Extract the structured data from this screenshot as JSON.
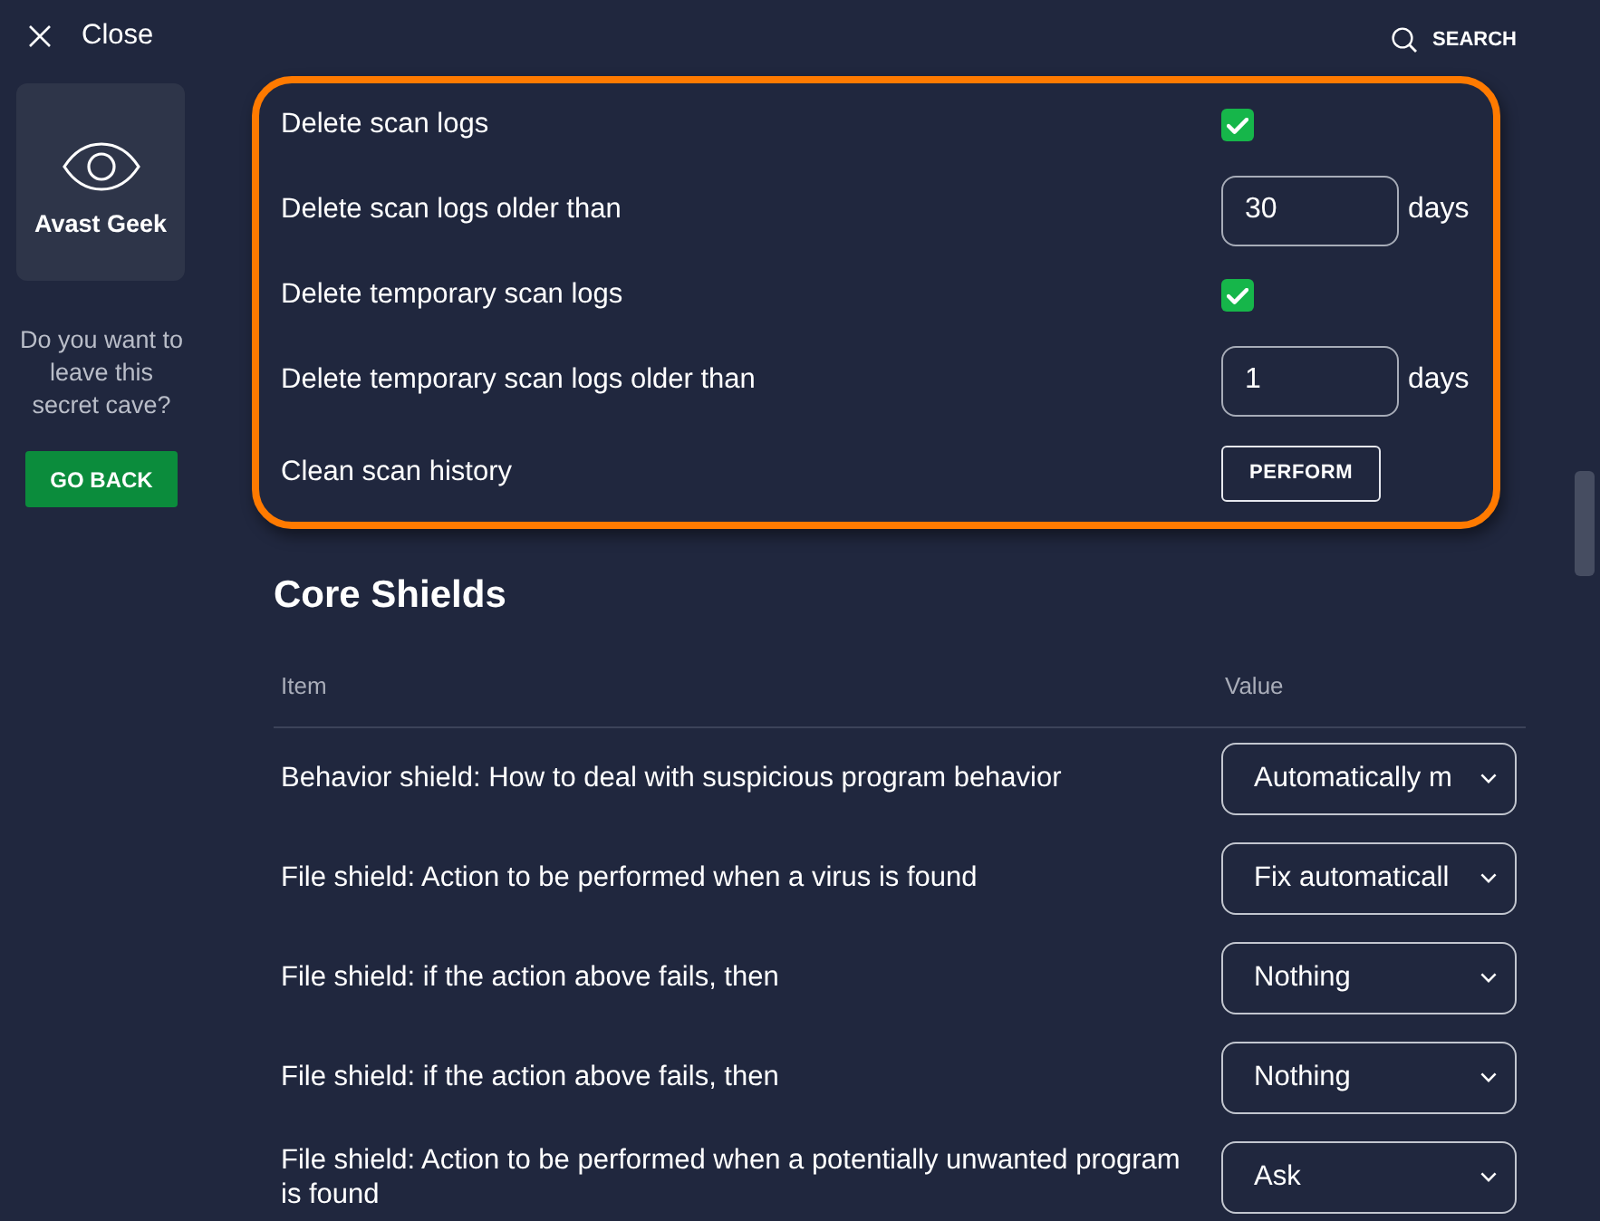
{
  "close_button": {
    "label": "Close"
  },
  "sidebar": {
    "card_title": "Avast Geek",
    "prompt": "Do you want to leave this secret cave?",
    "go_back_button": "GO BACK"
  },
  "search_button": {
    "label": "SEARCH"
  },
  "scan_log_settings": {
    "highlighted": true,
    "rows": [
      {
        "kind": "checkbox",
        "label": "Delete scan logs",
        "checked": true
      },
      {
        "kind": "number",
        "label": "Delete scan logs older than",
        "value": "30",
        "unit": "days"
      },
      {
        "kind": "checkbox",
        "label": "Delete temporary scan logs",
        "checked": true
      },
      {
        "kind": "number",
        "label": "Delete temporary scan logs older than",
        "value": "1",
        "unit": "days"
      },
      {
        "kind": "action",
        "label": "Clean scan history",
        "button": "PERFORM"
      }
    ]
  },
  "core_shields": {
    "title": "Core Shields",
    "columns": [
      "Item",
      "Value"
    ],
    "rows": [
      {
        "item": "Behavior shield: How to deal with suspicious program behavior",
        "value": "Automatically m"
      },
      {
        "item": "File shield: Action to be performed when a virus is found",
        "value": "Fix automaticall"
      },
      {
        "item": "File shield: if the action above fails, then",
        "value": "Nothing"
      },
      {
        "item": "File shield: if the action above fails, then",
        "value": "Nothing"
      },
      {
        "item": "File shield: Action to be performed when a potentially unwanted program is found",
        "value": "Ask"
      }
    ]
  }
}
